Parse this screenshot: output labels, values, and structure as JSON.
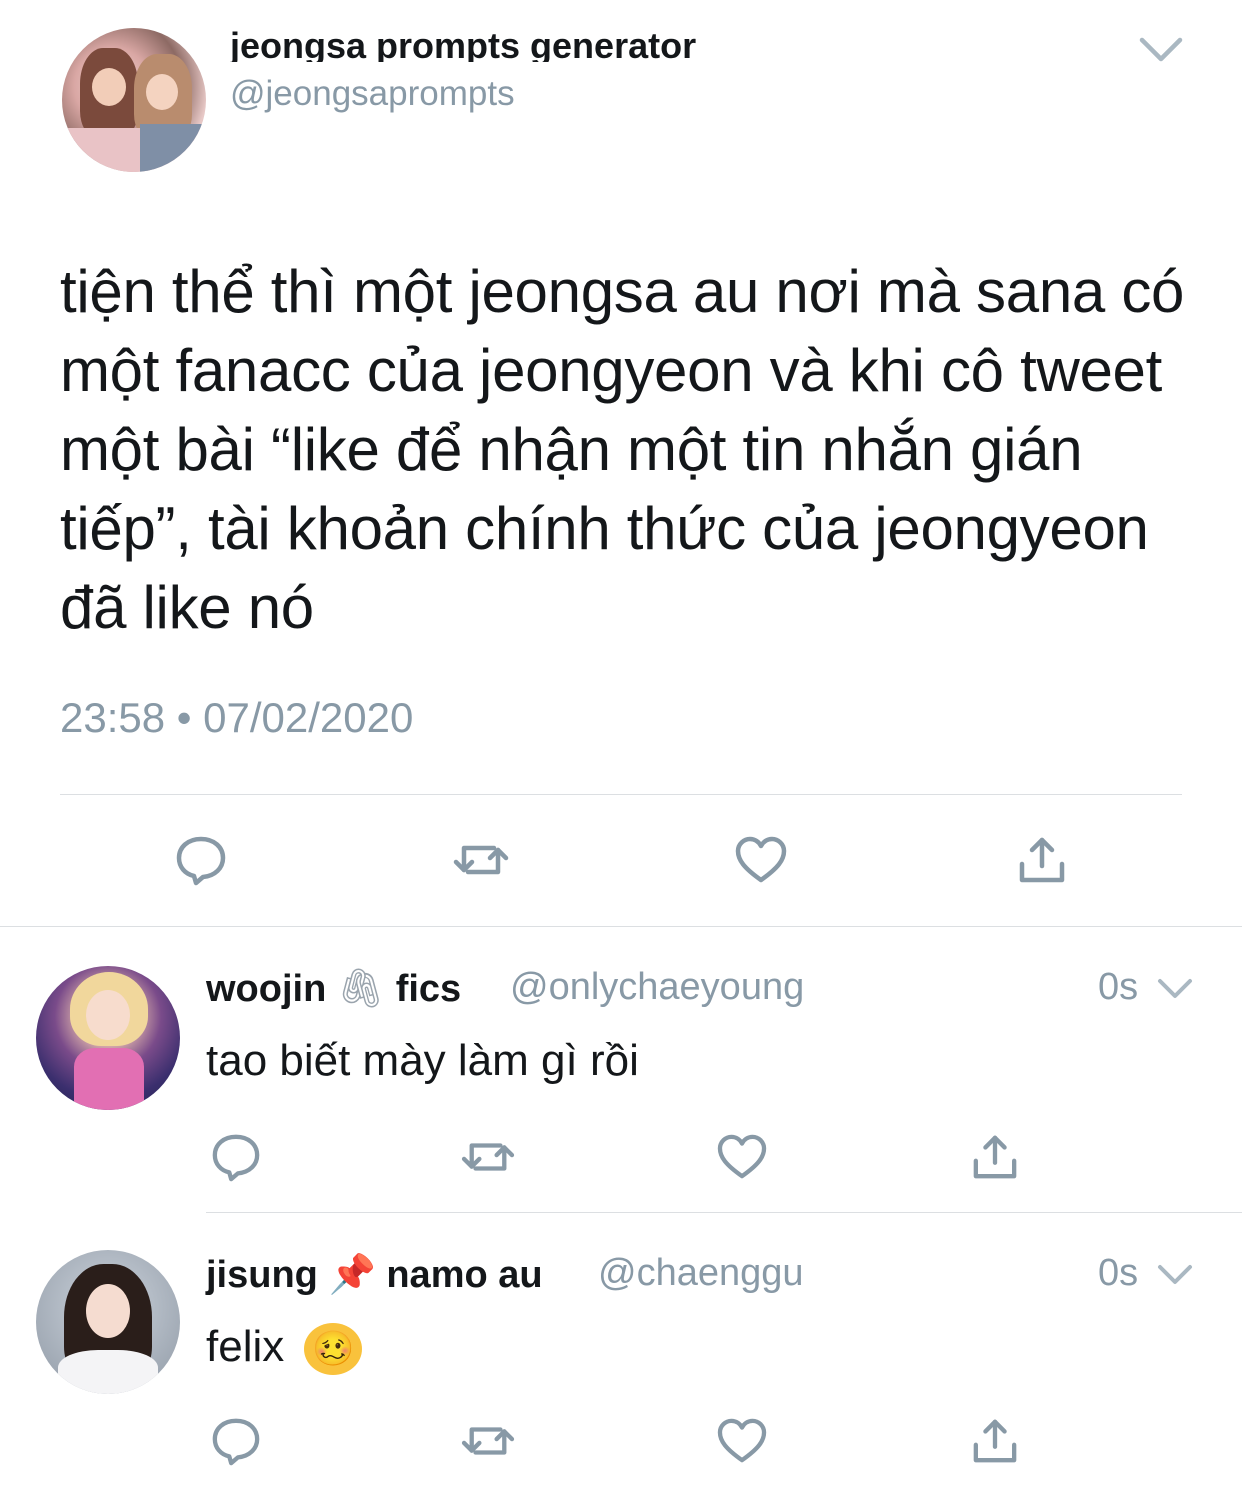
{
  "main_tweet": {
    "display_name": "jeongsa prompts generator",
    "handle": "@jeongsaprompts",
    "text": "tiện thể thì một jeongsa au nơi mà sana có một fanacc của jeongyeon và khi cô tweet một bài “like để nhận một tin nhắn gián tiếp”, tài khoản chính thức của jeongyeon đã like nó",
    "timestamp": "23:58 • 07/02/2020"
  },
  "replies": [
    {
      "name_part1": "woojin",
      "name_emoji": "🖇",
      "name_part2": "fics",
      "handle": "@onlychaeyoung",
      "time": "0s",
      "text": "tao biết mày làm gì rồi"
    },
    {
      "name_part1": "jisung",
      "name_emoji": "📌",
      "name_part2": "namo au",
      "handle": "@chaenggu",
      "time": "0s",
      "text": "felix",
      "text_emoji": "🥴"
    }
  ],
  "icons": {
    "reply": "reply-icon",
    "retweet": "retweet-icon",
    "like": "heart-icon",
    "share": "share-icon",
    "menu": "chevron-down-icon"
  },
  "colors": {
    "text": "#14171a",
    "secondary": "#8899a6",
    "divider": "#dcdfe2"
  }
}
